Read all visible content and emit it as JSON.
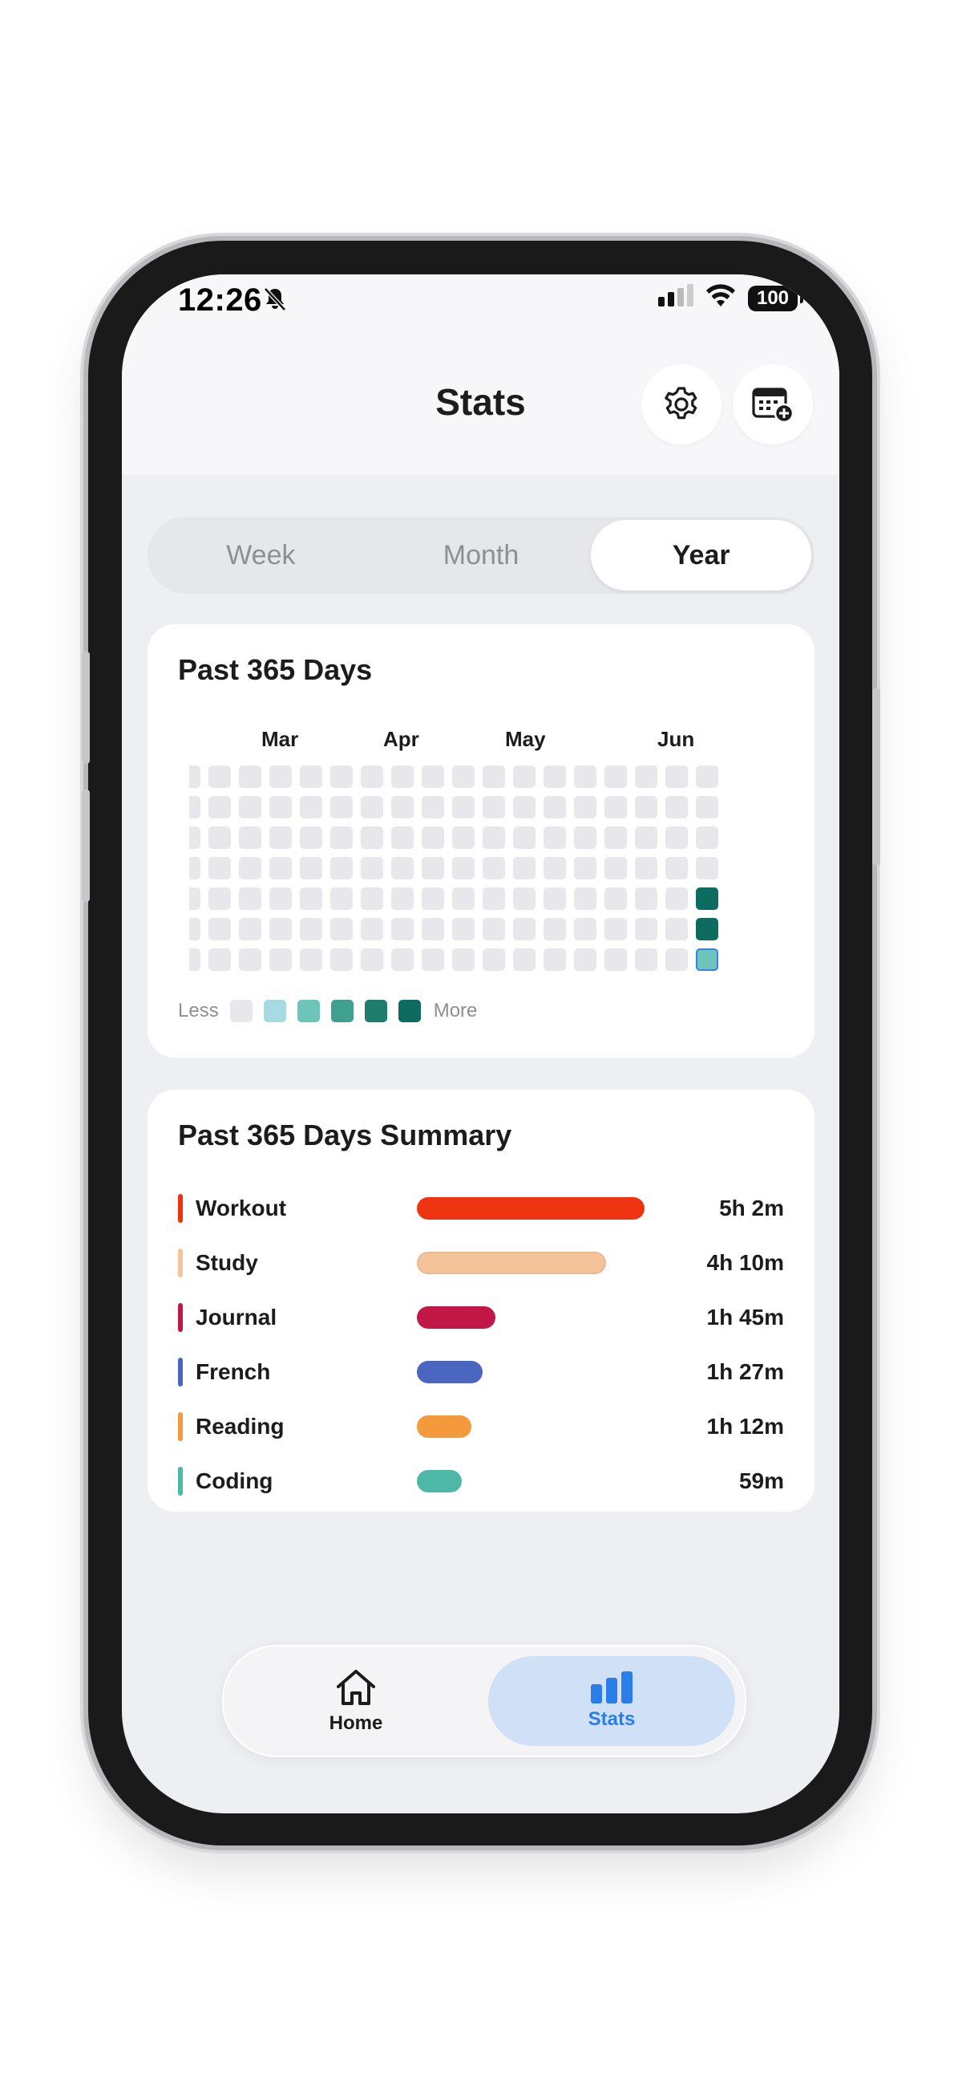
{
  "status_bar": {
    "time": "12:26",
    "battery": "100"
  },
  "header": {
    "title": "Stats"
  },
  "segment": {
    "options": [
      "Week",
      "Month",
      "Year"
    ],
    "selected": "Year"
  },
  "heatmap_card": {
    "title": "Past 365 Days",
    "months": [
      "Mar",
      "Apr",
      "May",
      "Jun"
    ],
    "legend": {
      "less": "Less",
      "more": "More",
      "colors": [
        "#e8e8ec",
        "#a6dbe3",
        "#6cc5b8",
        "#3f9f90",
        "#1f7d6e",
        "#0e6b5f"
      ]
    },
    "active_days": [
      {
        "row": 5,
        "col": 17,
        "level": 4
      },
      {
        "row": 6,
        "col": 17,
        "level": 4
      },
      {
        "row": 7,
        "col": 17,
        "level": 2,
        "selected": true
      }
    ]
  },
  "summary_card": {
    "title": "Past 365 Days Summary",
    "items": [
      {
        "name": "Workout",
        "value": "5h 2m",
        "color": "#ee3311"
      },
      {
        "name": "Study",
        "value": "4h 10m",
        "color": "#f5c39a"
      },
      {
        "name": "Journal",
        "value": "1h 45m",
        "color": "#c21847"
      },
      {
        "name": "French",
        "value": "1h 27m",
        "color": "#4a66c0"
      },
      {
        "name": "Reading",
        "value": "1h 12m",
        "color": "#f49a3c"
      },
      {
        "name": "Coding",
        "value": "59m",
        "color": "#4db8a6"
      }
    ]
  },
  "tab_bar": {
    "home": "Home",
    "stats": "Stats",
    "active_color": "#2b7de9"
  }
}
